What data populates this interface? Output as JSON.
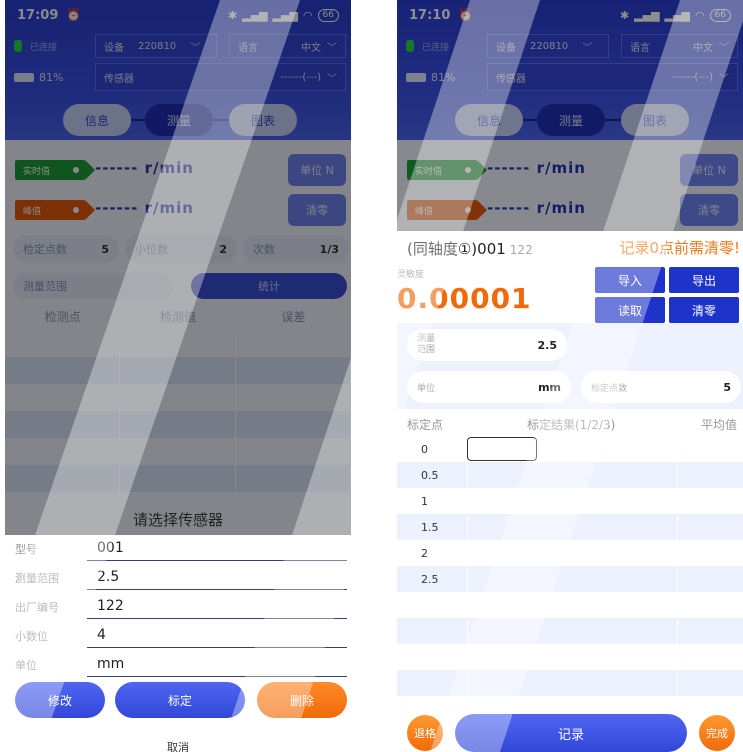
{
  "left": {
    "status": {
      "time": "17:09",
      "alarm_icon": "alarm-icon",
      "battery_badge": "66"
    },
    "header": {
      "connection": "已连接",
      "device_label": "设备",
      "device_value": "220810",
      "language_label": "语言",
      "language_value": "中文",
      "battery_pct": "81%",
      "sensor_label": "传感器",
      "sensor_value": "------(---)"
    },
    "tabs": [
      "信息",
      "测量",
      "图表"
    ],
    "readings": {
      "realtime_tag": "实时值",
      "realtime_value": "------ r/min",
      "unit_btn": "单位 N",
      "peak_tag": "峰值",
      "peak_value": "------ r/min",
      "zero_btn": "清零"
    },
    "params": {
      "points_label": "检定点数",
      "points_value": "5",
      "decimals_label": "小位数",
      "decimals_value": "2",
      "count_label": "次数",
      "count_value": "1/3"
    },
    "range_label": "测量范围",
    "stat_btn": "统计",
    "table_headers": [
      "检测点",
      "检测值",
      "误差"
    ],
    "sheet": {
      "title": "请选择传感器",
      "fields": [
        {
          "label": "型号",
          "value": "001"
        },
        {
          "label": "测量范围",
          "value": "2.5"
        },
        {
          "label": "出厂编号",
          "value": "122"
        },
        {
          "label": "小数位",
          "value": "4"
        },
        {
          "label": "单位",
          "value": "mm"
        }
      ],
      "btn_edit": "修改",
      "btn_calibrate": "标定",
      "btn_delete": "删除",
      "cancel": "取消"
    }
  },
  "right": {
    "status": {
      "time": "17:10",
      "battery_badge": "66"
    },
    "header": {
      "connection": "已连接",
      "device_label": "设备",
      "device_value": "220810",
      "language_label": "语言",
      "language_value": "中文",
      "battery_pct": "81%",
      "sensor_label": "传感器",
      "sensor_value": "------(---)"
    },
    "tabs": [
      "信息",
      "测量",
      "图表"
    ],
    "readings": {
      "realtime_tag": "实时值",
      "realtime_value": "------ r/min",
      "unit_btn": "单位 N",
      "peak_tag": "峰值",
      "peak_value": "------ r/min",
      "zero_btn": "清零"
    },
    "calib": {
      "title": "(同轴度①)001",
      "serial": "122",
      "warning": "记录0点前需清零!",
      "small_label": "灵敏度",
      "big_value": "0.00001",
      "btn_import": "导入",
      "btn_export": "导出",
      "btn_read": "读取",
      "btn_zero": "清零",
      "range_label": "测量范围",
      "range_value": "2.5",
      "unit_label": "单位",
      "unit_value": "mm",
      "points_label": "标定点数",
      "points_value": "5",
      "headers": [
        "标定点",
        "标定结果(1/2/3)",
        "平均值"
      ],
      "points": [
        "0",
        "0.5",
        "1",
        "1.5",
        "2",
        "2.5"
      ],
      "btn_fail": "退格",
      "btn_record": "记录",
      "btn_done": "完成"
    }
  }
}
